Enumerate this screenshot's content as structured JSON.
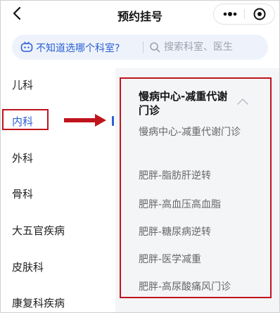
{
  "header": {
    "title": "预约挂号"
  },
  "search": {
    "ask_label": "不知道选哪个科室?",
    "placeholder": "搜索科室、医生"
  },
  "departments": [
    "儿科",
    "内科",
    "外科",
    "骨科",
    "大五官疾病",
    "皮肤科",
    "康复科疾病"
  ],
  "selected_department": "内科",
  "panel": {
    "group_title": "慢病中心-减重代谢门诊",
    "items": [
      "慢病中心-减重代谢门诊",
      "肥胖-脂肪肝逆转",
      "肥胖-高血压高血脂",
      "肥胖-糖尿病逆转",
      "肥胖-医学减重",
      "肥胖-高尿酸痛风门诊"
    ]
  },
  "colors": {
    "accent": "#2a5fd4",
    "annotation_red": "#c0141d",
    "panel_bg": "#f4f5f7"
  },
  "icons": [
    "back-icon",
    "more-icon",
    "close-icon",
    "robot-icon",
    "search-icon",
    "chevron-up-icon"
  ]
}
